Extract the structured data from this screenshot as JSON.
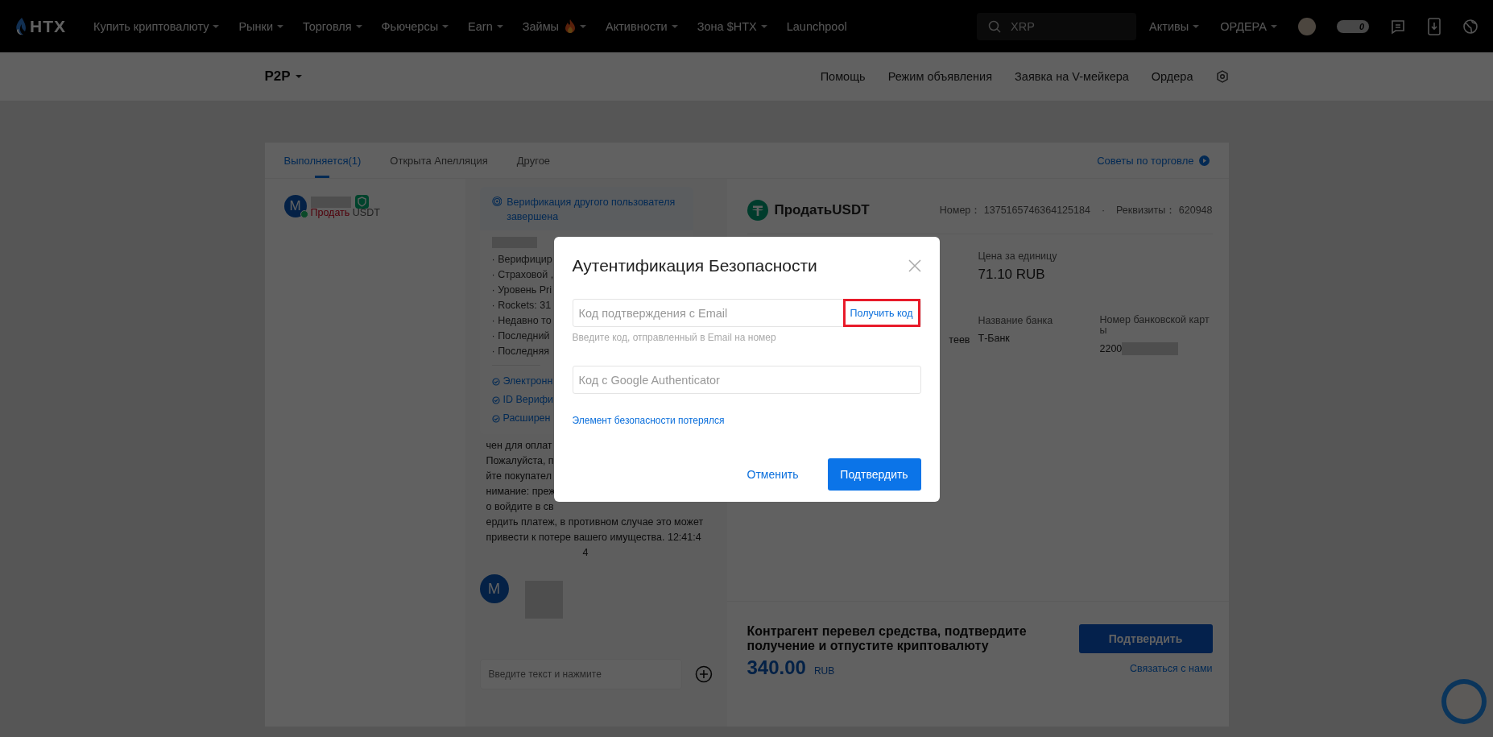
{
  "top_nav": {
    "logo": "HTX",
    "menu": [
      {
        "label": "Купить криптовалюту",
        "dropdown": true,
        "hot": false
      },
      {
        "label": "Рынки",
        "dropdown": true,
        "hot": false
      },
      {
        "label": "Торговля",
        "dropdown": true,
        "hot": false
      },
      {
        "label": "Фьючерсы",
        "dropdown": true,
        "hot": false
      },
      {
        "label": "Earn",
        "dropdown": true,
        "hot": false
      },
      {
        "label": "Займы",
        "dropdown": true,
        "hot": true
      },
      {
        "label": "Активности",
        "dropdown": true,
        "hot": false
      },
      {
        "label": "Зона $HTX",
        "dropdown": true,
        "hot": false
      },
      {
        "label": "Launchpool",
        "dropdown": false,
        "hot": false
      }
    ],
    "search": {
      "placeholder": "XRP"
    },
    "links": [
      {
        "label": "Активы",
        "dropdown": true
      },
      {
        "label": "ОРДЕРА",
        "dropdown": true
      }
    ],
    "badge_count": "0"
  },
  "sub_nav": {
    "title": "P2P",
    "links": [
      "Помощь",
      "Режим объявления",
      "Заявка на V-мейкера",
      "Ордера"
    ]
  },
  "order_tabs": [
    {
      "label": "Выполняется(1)",
      "selected": true
    },
    {
      "label": "Открыта Апелляция",
      "selected": false
    },
    {
      "label": "Другое",
      "selected": false
    }
  ],
  "tips_link": "Советы по торговле",
  "chat_list": [
    {
      "avatar": "M",
      "online": true,
      "side": "Продать",
      "asset": "USDT"
    }
  ],
  "chat": {
    "verification": {
      "title": "Верификация другого пользователя завершена",
      "details": [
        "· Верифицир",
        "· Страховой ,",
        "· Уровень Pri",
        "· Rockets: 31",
        "· Недавно то",
        "· Последний",
        "· Последняя"
      ],
      "checks": [
        "Электронн",
        "ID Верифи",
        "Расширен"
      ]
    },
    "message_lines": [
      "чен для оплат",
      "Пожалуйста, п",
      "йте покупател",
      "нимание: преж",
      "о войдите в св",
      "ердить платеж, в противном случае это может",
      "привести к потере вашего имущества. 12:41:4",
      "4"
    ],
    "peer_avatar": "M",
    "input_placeholder": "Введите текст и нажмите"
  },
  "order": {
    "title": "ПродатьUSDT",
    "number_label": "Номер：",
    "number": "1375165746364125184",
    "details_label": "Реквизиты：",
    "details": "620948",
    "separator": "·",
    "price_label": "Цена за единицу",
    "price": "71.10 RUB",
    "name_fragment": "теев",
    "bank_label": "Название банка",
    "bank": "Т-Банк",
    "card_label": "Номер банковской карты",
    "card_prefix": "2200"
  },
  "footer": {
    "message": "Контрагент перевел средства, подтвердите получение и отпустите криптовалюту",
    "amount": "340.00",
    "currency": "RUB",
    "confirm": "Подтвердить",
    "contact": "Связаться с нами"
  },
  "modal": {
    "title": "Аутентификация Безопасности",
    "email_field": {
      "placeholder": "Код подтверждения с Email",
      "action": "Получить код",
      "action_highlighted": true
    },
    "email_hint": "Введите код, отправленный в Email на номер",
    "google_field": {
      "placeholder": "Код с Google Authenticator"
    },
    "lost_link": "Элемент безопасности потерялся",
    "cancel": "Отменить",
    "confirm": "Подтвердить"
  }
}
